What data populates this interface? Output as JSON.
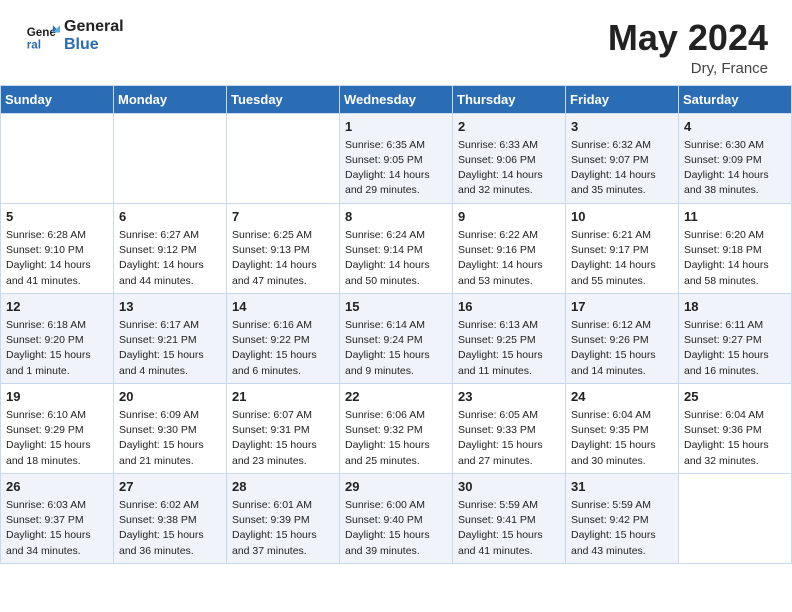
{
  "header": {
    "logo_line1": "General",
    "logo_line2": "Blue",
    "month_year": "May 2024",
    "location": "Dry, France"
  },
  "days_of_week": [
    "Sunday",
    "Monday",
    "Tuesday",
    "Wednesday",
    "Thursday",
    "Friday",
    "Saturday"
  ],
  "weeks": [
    [
      {
        "day": "",
        "info": ""
      },
      {
        "day": "",
        "info": ""
      },
      {
        "day": "",
        "info": ""
      },
      {
        "day": "1",
        "info": "Sunrise: 6:35 AM\nSunset: 9:05 PM\nDaylight: 14 hours\nand 29 minutes."
      },
      {
        "day": "2",
        "info": "Sunrise: 6:33 AM\nSunset: 9:06 PM\nDaylight: 14 hours\nand 32 minutes."
      },
      {
        "day": "3",
        "info": "Sunrise: 6:32 AM\nSunset: 9:07 PM\nDaylight: 14 hours\nand 35 minutes."
      },
      {
        "day": "4",
        "info": "Sunrise: 6:30 AM\nSunset: 9:09 PM\nDaylight: 14 hours\nand 38 minutes."
      }
    ],
    [
      {
        "day": "5",
        "info": "Sunrise: 6:28 AM\nSunset: 9:10 PM\nDaylight: 14 hours\nand 41 minutes."
      },
      {
        "day": "6",
        "info": "Sunrise: 6:27 AM\nSunset: 9:12 PM\nDaylight: 14 hours\nand 44 minutes."
      },
      {
        "day": "7",
        "info": "Sunrise: 6:25 AM\nSunset: 9:13 PM\nDaylight: 14 hours\nand 47 minutes."
      },
      {
        "day": "8",
        "info": "Sunrise: 6:24 AM\nSunset: 9:14 PM\nDaylight: 14 hours\nand 50 minutes."
      },
      {
        "day": "9",
        "info": "Sunrise: 6:22 AM\nSunset: 9:16 PM\nDaylight: 14 hours\nand 53 minutes."
      },
      {
        "day": "10",
        "info": "Sunrise: 6:21 AM\nSunset: 9:17 PM\nDaylight: 14 hours\nand 55 minutes."
      },
      {
        "day": "11",
        "info": "Sunrise: 6:20 AM\nSunset: 9:18 PM\nDaylight: 14 hours\nand 58 minutes."
      }
    ],
    [
      {
        "day": "12",
        "info": "Sunrise: 6:18 AM\nSunset: 9:20 PM\nDaylight: 15 hours\nand 1 minute."
      },
      {
        "day": "13",
        "info": "Sunrise: 6:17 AM\nSunset: 9:21 PM\nDaylight: 15 hours\nand 4 minutes."
      },
      {
        "day": "14",
        "info": "Sunrise: 6:16 AM\nSunset: 9:22 PM\nDaylight: 15 hours\nand 6 minutes."
      },
      {
        "day": "15",
        "info": "Sunrise: 6:14 AM\nSunset: 9:24 PM\nDaylight: 15 hours\nand 9 minutes."
      },
      {
        "day": "16",
        "info": "Sunrise: 6:13 AM\nSunset: 9:25 PM\nDaylight: 15 hours\nand 11 minutes."
      },
      {
        "day": "17",
        "info": "Sunrise: 6:12 AM\nSunset: 9:26 PM\nDaylight: 15 hours\nand 14 minutes."
      },
      {
        "day": "18",
        "info": "Sunrise: 6:11 AM\nSunset: 9:27 PM\nDaylight: 15 hours\nand 16 minutes."
      }
    ],
    [
      {
        "day": "19",
        "info": "Sunrise: 6:10 AM\nSunset: 9:29 PM\nDaylight: 15 hours\nand 18 minutes."
      },
      {
        "day": "20",
        "info": "Sunrise: 6:09 AM\nSunset: 9:30 PM\nDaylight: 15 hours\nand 21 minutes."
      },
      {
        "day": "21",
        "info": "Sunrise: 6:07 AM\nSunset: 9:31 PM\nDaylight: 15 hours\nand 23 minutes."
      },
      {
        "day": "22",
        "info": "Sunrise: 6:06 AM\nSunset: 9:32 PM\nDaylight: 15 hours\nand 25 minutes."
      },
      {
        "day": "23",
        "info": "Sunrise: 6:05 AM\nSunset: 9:33 PM\nDaylight: 15 hours\nand 27 minutes."
      },
      {
        "day": "24",
        "info": "Sunrise: 6:04 AM\nSunset: 9:35 PM\nDaylight: 15 hours\nand 30 minutes."
      },
      {
        "day": "25",
        "info": "Sunrise: 6:04 AM\nSunset: 9:36 PM\nDaylight: 15 hours\nand 32 minutes."
      }
    ],
    [
      {
        "day": "26",
        "info": "Sunrise: 6:03 AM\nSunset: 9:37 PM\nDaylight: 15 hours\nand 34 minutes."
      },
      {
        "day": "27",
        "info": "Sunrise: 6:02 AM\nSunset: 9:38 PM\nDaylight: 15 hours\nand 36 minutes."
      },
      {
        "day": "28",
        "info": "Sunrise: 6:01 AM\nSunset: 9:39 PM\nDaylight: 15 hours\nand 37 minutes."
      },
      {
        "day": "29",
        "info": "Sunrise: 6:00 AM\nSunset: 9:40 PM\nDaylight: 15 hours\nand 39 minutes."
      },
      {
        "day": "30",
        "info": "Sunrise: 5:59 AM\nSunset: 9:41 PM\nDaylight: 15 hours\nand 41 minutes."
      },
      {
        "day": "31",
        "info": "Sunrise: 5:59 AM\nSunset: 9:42 PM\nDaylight: 15 hours\nand 43 minutes."
      },
      {
        "day": "",
        "info": ""
      }
    ]
  ]
}
